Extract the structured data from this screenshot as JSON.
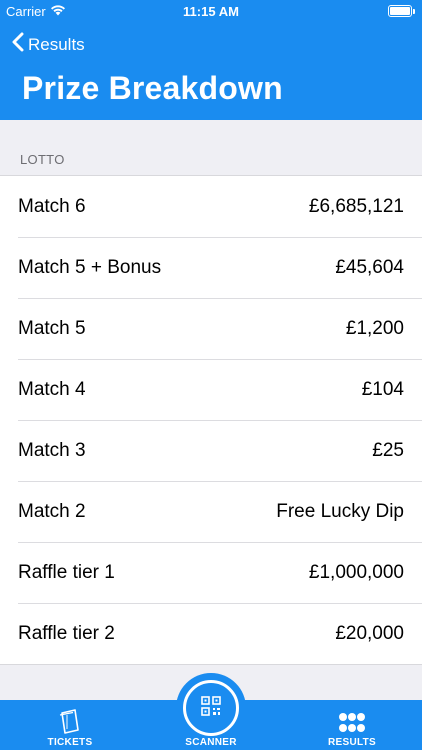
{
  "status_bar": {
    "carrier": "Carrier",
    "time": "11:15 AM"
  },
  "nav": {
    "back_label": "Results",
    "title": "Prize Breakdown"
  },
  "section": {
    "header": "LOTTO"
  },
  "prizes": [
    {
      "label": "Match 6",
      "value": "£6,685,121"
    },
    {
      "label": "Match 5 + Bonus",
      "value": "£45,604"
    },
    {
      "label": "Match 5",
      "value": "£1,200"
    },
    {
      "label": "Match 4",
      "value": "£104"
    },
    {
      "label": "Match 3",
      "value": "£25"
    },
    {
      "label": "Match 2",
      "value": "Free Lucky Dip"
    },
    {
      "label": "Raffle tier 1",
      "value": "£1,000,000"
    },
    {
      "label": "Raffle tier 2",
      "value": "£20,000"
    }
  ],
  "tabbar": {
    "tickets": "TICKETS",
    "scanner": "SCANNER",
    "results": "RESULTS"
  },
  "colors": {
    "accent": "#1a8cf0",
    "background": "#efeff4"
  }
}
